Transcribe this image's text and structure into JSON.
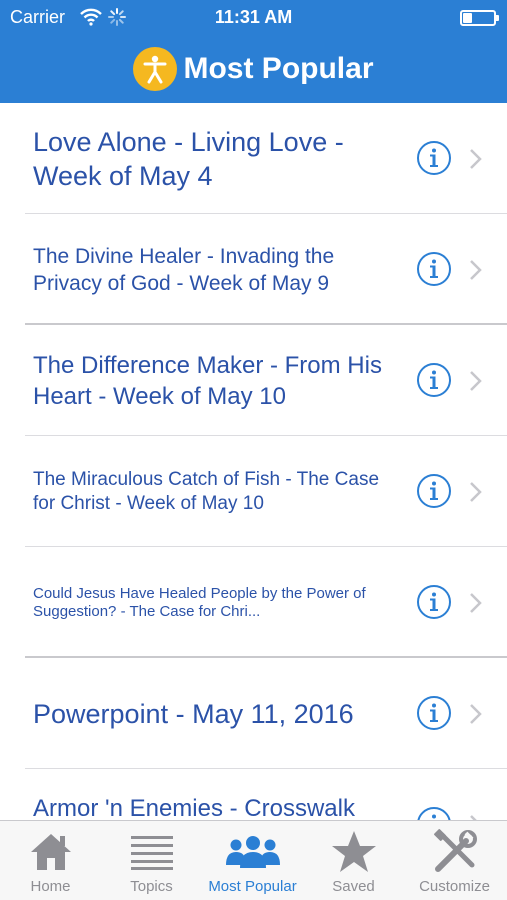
{
  "status_bar": {
    "carrier": "Carrier",
    "time": "11:31 AM",
    "battery_level": 0.3
  },
  "nav": {
    "title": "Most Popular",
    "logo_icon": "person-icon"
  },
  "items": [
    {
      "title": "Love Alone - Living Love - Week of May 4"
    },
    {
      "title": "The Divine Healer - Invading the Privacy of God - Week of May 9"
    },
    {
      "title": "The Difference Maker - From His Heart - Week of May 10"
    },
    {
      "title": "The Miraculous Catch of Fish - The Case for Christ - Week of May 10"
    },
    {
      "title": "Could Jesus Have Healed People by the Power of Suggestion? - The Case for Chri..."
    },
    {
      "title": "Powerpoint - May 11, 2016"
    },
    {
      "title": "Armor 'n Enemies - Crosswalk"
    }
  ],
  "tabs": [
    {
      "label": "Home",
      "icon": "home-icon"
    },
    {
      "label": "Topics",
      "icon": "list-icon"
    },
    {
      "label": "Most Popular",
      "icon": "people-icon"
    },
    {
      "label": "Saved",
      "icon": "star-icon"
    },
    {
      "label": "Customize",
      "icon": "tools-icon"
    }
  ],
  "colors": {
    "header": "#2b7fd4",
    "link_text": "#2b52a8",
    "accent": "#2b7fd4",
    "inactive_tab": "#8e8e93",
    "logo": "#f5b820"
  }
}
